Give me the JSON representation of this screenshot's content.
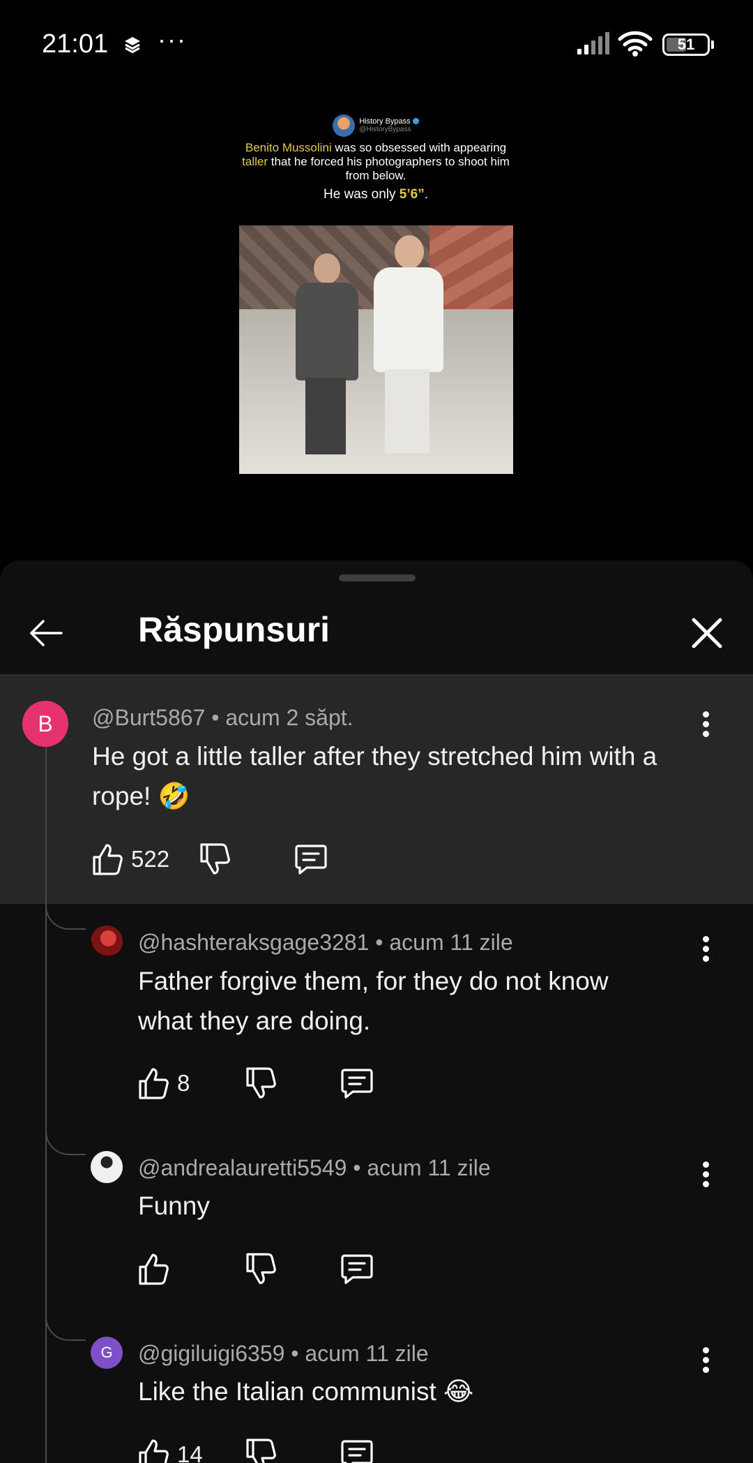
{
  "status_bar": {
    "time": "21:01",
    "overflow": "···",
    "battery": "51",
    "icons": [
      "layers-icon",
      "signal-icon",
      "wifi-icon",
      "battery-icon"
    ]
  },
  "video_post": {
    "author_name": "History Bypass",
    "author_handle": "@HistoryBypass",
    "text_highlight_1": "Benito Mussolini",
    "text_part_1": " was so obsessed with appearing ",
    "text_highlight_2": "taller",
    "text_part_2": " that he forced his photographers to shoot him from below.",
    "sub_part": "He was only ",
    "sub_highlight": "5’6”",
    "sub_end": "."
  },
  "sheet": {
    "title": "Răspunsuri",
    "back_icon": "arrow-left-icon",
    "close_icon": "close-icon"
  },
  "comments": [
    {
      "avatar_letter": "B",
      "avatar_color": "#e63370",
      "meta": "@Burt5867 • acum 2 săpt.",
      "text": "He got a little taller after they stretched him with a rope! 🤣",
      "likes": "522"
    },
    {
      "avatar_letter": "",
      "avatar_color": "#8b1f1f",
      "meta": "@hashteraksgage3281 • acum 11 zile",
      "text": "Father forgive them, for they do not know what they are doing.",
      "likes": "8"
    },
    {
      "avatar_letter": "",
      "avatar_color": "#e8e8e8",
      "meta": "@andrealauretti5549 • acum 11 zile",
      "text": "Funny",
      "likes": ""
    },
    {
      "avatar_letter": "G",
      "avatar_color": "#7e4fc7",
      "meta": "@gigiluigi6359 • acum 11 zile",
      "text": "Like the Italian communist 😂",
      "likes": "14"
    }
  ]
}
